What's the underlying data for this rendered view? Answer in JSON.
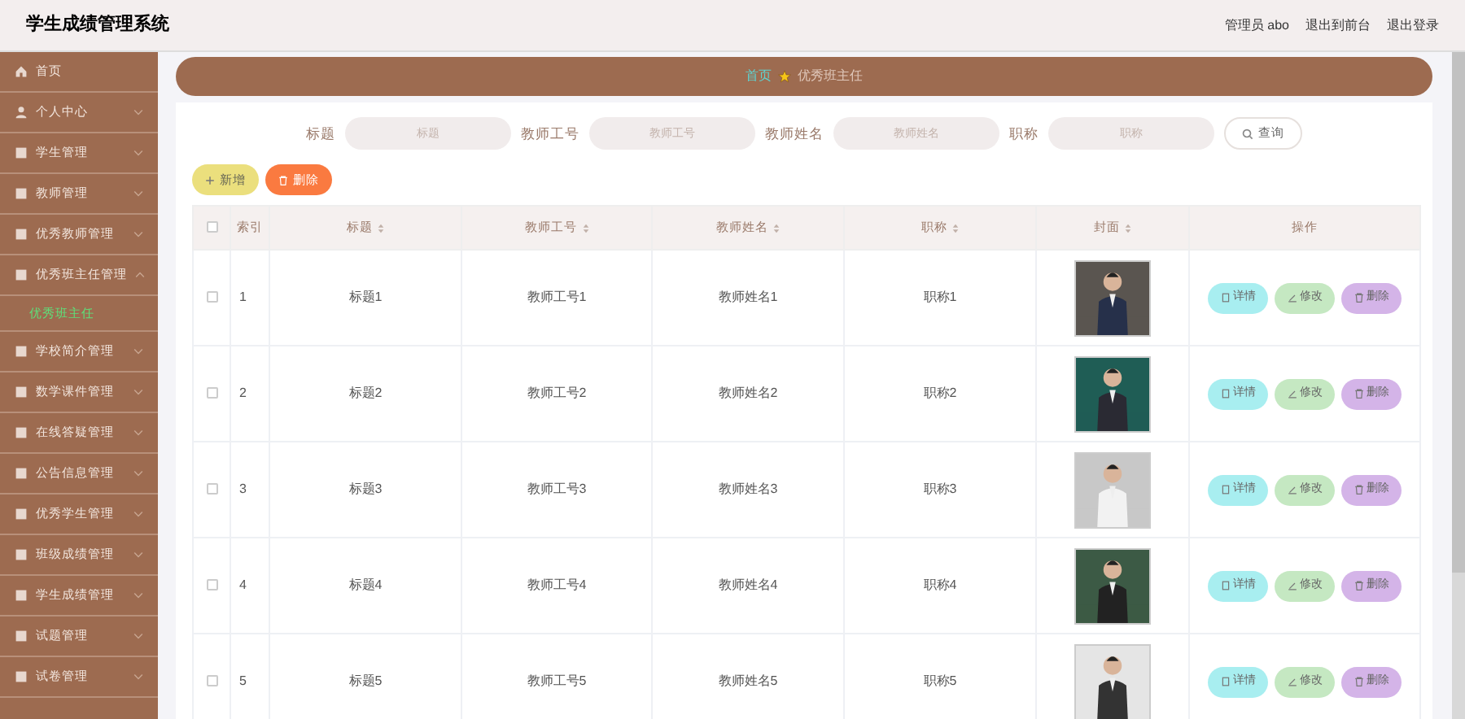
{
  "header": {
    "title": "学生成绩管理系统",
    "links": [
      "管理员 abo",
      "退出到前台",
      "退出登录"
    ]
  },
  "sidebar": {
    "items": [
      {
        "label": "首页"
      },
      {
        "label": "个人中心",
        "expanded": false
      },
      {
        "label": "学生管理",
        "expanded": false
      },
      {
        "label": "教师管理",
        "expanded": false
      },
      {
        "label": "优秀教师管理",
        "expanded": false
      },
      {
        "label": "优秀班主任管理",
        "expanded": true,
        "children": [
          {
            "label": "优秀班主任",
            "selected": true
          }
        ]
      },
      {
        "label": "学校简介管理",
        "expanded": false
      },
      {
        "label": "数学课件管理",
        "expanded": false
      },
      {
        "label": "在线答疑管理",
        "expanded": false
      },
      {
        "label": "公告信息管理",
        "expanded": false
      },
      {
        "label": "优秀学生管理",
        "expanded": false
      },
      {
        "label": "班级成绩管理",
        "expanded": false
      },
      {
        "label": "学生成绩管理",
        "expanded": false
      },
      {
        "label": "试题管理",
        "expanded": false
      },
      {
        "label": "试卷管理",
        "expanded": false
      }
    ]
  },
  "breadcrumb": [
    "首页",
    "优秀班主任"
  ],
  "search": {
    "fields": [
      {
        "label": "标题",
        "placeholder": "标题"
      },
      {
        "label": "教师工号",
        "placeholder": "教师工号"
      },
      {
        "label": "教师姓名",
        "placeholder": "教师姓名"
      },
      {
        "label": "职称",
        "placeholder": "职称"
      }
    ],
    "button": "查询"
  },
  "actions": [
    "新增",
    "删除"
  ],
  "table": {
    "select_all_checked": false,
    "columns": [
      {
        "label": "索引",
        "sortable": false
      },
      {
        "label": "标题",
        "sortable": true
      },
      {
        "label": "教师工号",
        "sortable": true
      },
      {
        "label": "教师姓名",
        "sortable": true
      },
      {
        "label": "职称",
        "sortable": true
      },
      {
        "label": "封面",
        "sortable": true
      },
      {
        "label": "操作",
        "sortable": false
      }
    ],
    "rows": [
      {
        "cells": [
          "1",
          "标题1",
          "教师工号1",
          "教师姓名1",
          "职称1"
        ],
        "checked": false,
        "cover": {
          "kind": "picture"
        },
        "buttons": [
          "详情",
          "修改",
          "删除"
        ]
      },
      {
        "cells": [
          "2",
          "标题2",
          "教师工号2",
          "教师姓名2",
          "职称2"
        ],
        "checked": false,
        "cover": {
          "kind": "picture"
        },
        "buttons": [
          "详情",
          "修改",
          "删除"
        ]
      },
      {
        "cells": [
          "3",
          "标题3",
          "教师工号3",
          "教师姓名3",
          "职称3"
        ],
        "checked": false,
        "cover": {
          "kind": "picture"
        },
        "buttons": [
          "详情",
          "修改",
          "删除"
        ]
      },
      {
        "cells": [
          "4",
          "标题4",
          "教师工号4",
          "教师姓名4",
          "职称4"
        ],
        "checked": false,
        "cover": {
          "kind": "picture"
        },
        "buttons": [
          "详情",
          "修改",
          "删除"
        ]
      },
      {
        "cells": [
          "5",
          "标题5",
          "教师工号5",
          "教师姓名5",
          "职称5"
        ],
        "checked": false,
        "cover": {
          "kind": "picture"
        },
        "buttons": [
          "详情",
          "修改",
          "删除"
        ]
      }
    ]
  }
}
